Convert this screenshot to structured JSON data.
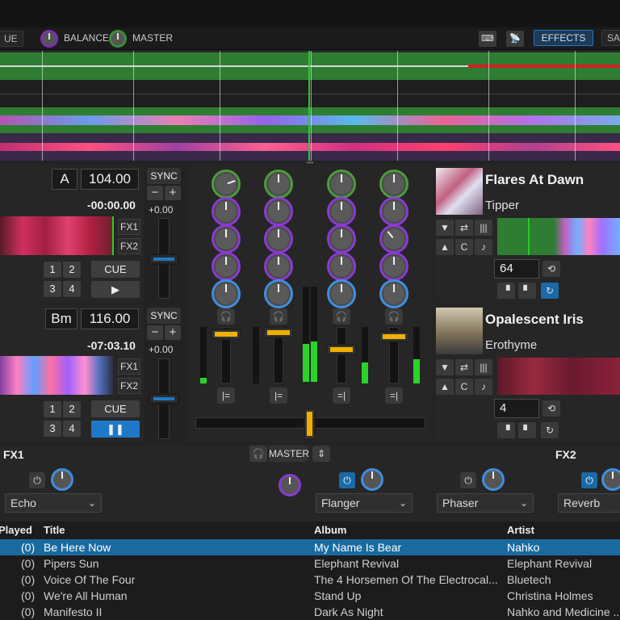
{
  "toolbar": {
    "cue_label": "UE",
    "balance_label": "BALANCE",
    "master_label": "MASTER",
    "effects_label": "EFFECTS",
    "sampler_label": "SA"
  },
  "deckA": {
    "key": "A",
    "bpm": "104.00",
    "time": "-00:00.00",
    "sync_label": "SYNC",
    "pitch_value": "+0.00",
    "minus": "−",
    "plus": "+",
    "fx1": "FX1",
    "fx2": "FX2",
    "hotcues": [
      "1",
      "2",
      "3",
      "4"
    ],
    "cue_label": "CUE",
    "play_label": "▶"
  },
  "deckB": {
    "key": "Bm",
    "bpm": "116.00",
    "time": "-07:03.10",
    "sync_label": "SYNC",
    "pitch_value": "+0.00",
    "minus": "−",
    "plus": "+",
    "fx1": "FX1",
    "fx2": "FX2",
    "hotcues": [
      "1",
      "2",
      "3",
      "4"
    ],
    "cue_label": "CUE",
    "play_label": "❚❚"
  },
  "trackA": {
    "title": "Flares At Dawn",
    "artist": "Tipper",
    "loop_size": "64"
  },
  "trackB": {
    "title": "Opalescent Iris",
    "artist": "Erothyme",
    "loop_size": "4"
  },
  "fx": {
    "fx1_label": "FX1",
    "fx2_label": "FX2",
    "master_label": "MASTER",
    "units": [
      {
        "name": "Echo"
      },
      {
        "name": "Flanger"
      },
      {
        "name": "Phaser"
      },
      {
        "name": "Reverb"
      }
    ]
  },
  "library": {
    "headers": {
      "played": "Played",
      "title": "Title",
      "album": "Album",
      "artist": "Artist"
    },
    "rows": [
      {
        "played": "(0)",
        "title": "Be Here Now",
        "album": "My Name Is Bear",
        "artist": "Nahko"
      },
      {
        "played": "(0)",
        "title": "Pipers Sun",
        "album": "Elephant Revival",
        "artist": "Elephant Revival"
      },
      {
        "played": "(0)",
        "title": "Voice Of The Four",
        "album": "The 4 Horsemen Of The Electrocal...",
        "artist": "Bluetech"
      },
      {
        "played": "(0)",
        "title": "We're All Human",
        "album": "Stand Up",
        "artist": "Christina Holmes"
      },
      {
        "played": "(0)",
        "title": "Manifesto II",
        "album": "Dark As Night",
        "artist": "Nahko and Medicine ..."
      }
    ]
  },
  "colors": {
    "accent_blue": "#1e78c8",
    "fader_yellow": "#f0b000",
    "vu_green": "#2bd42b",
    "ring_purple": "#8a3ad0",
    "ring_green": "#4c9c3c",
    "ring_blue": "#3f8ee0",
    "wave_green": "#2e7d32"
  }
}
